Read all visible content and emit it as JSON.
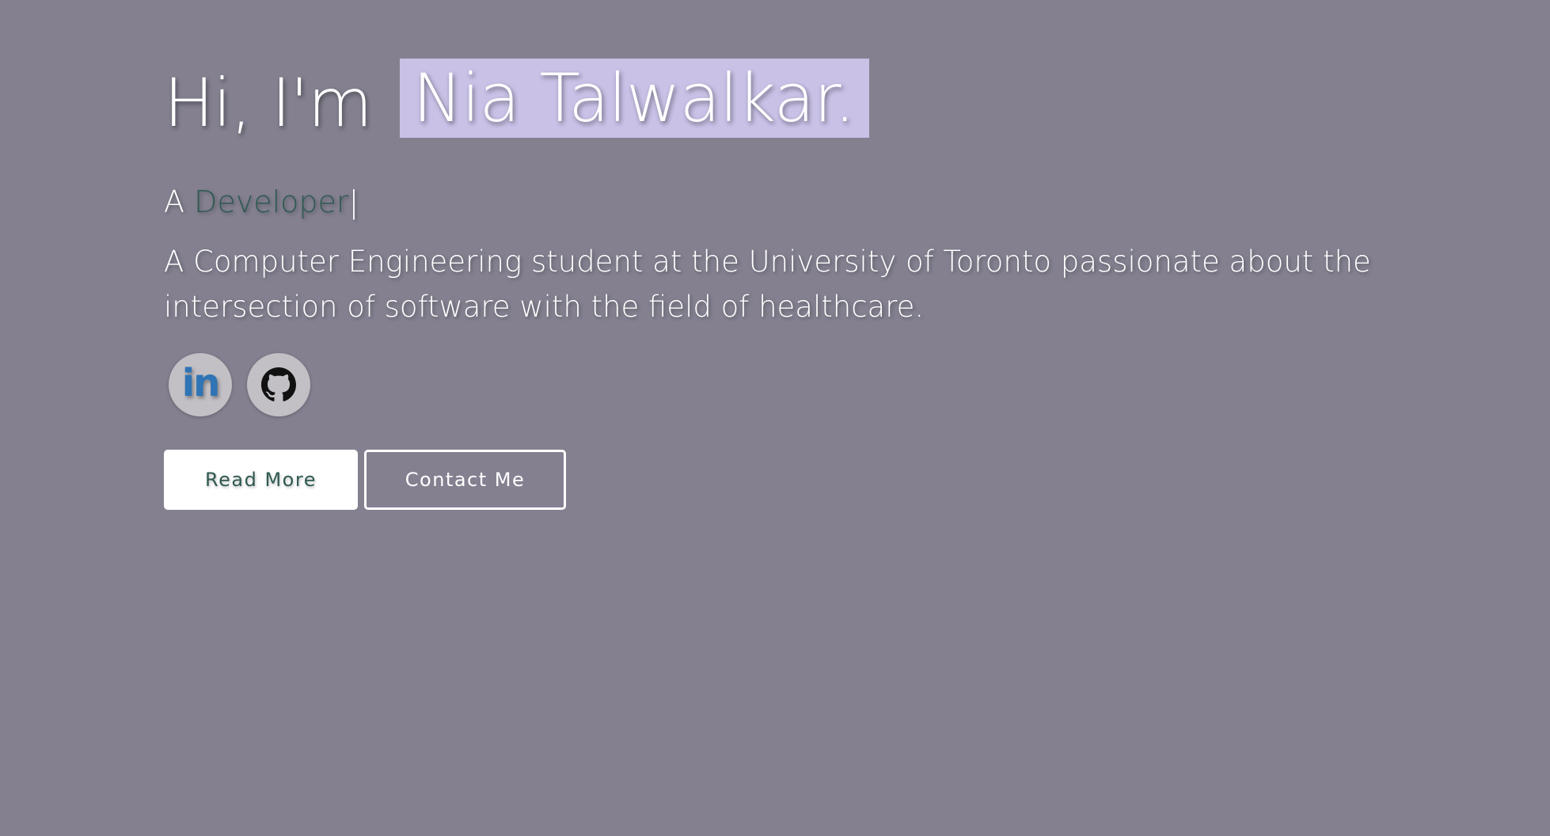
{
  "hero": {
    "greeting_prefix": "Hi, I'm",
    "name": "Nia Talwalkar.",
    "tagline_prefix": "A",
    "tagline_role": "Developer",
    "tagline_cursor": "|",
    "bio": "A Computer Engineering student at the University of Toronto passionate about the intersection of software with the field of healthcare."
  },
  "socials": {
    "linkedin_glyph": "in",
    "linkedin_icon": "linkedin-icon",
    "github_icon": "github-icon"
  },
  "buttons": {
    "read_more": "Read More",
    "contact_me": "Contact Me"
  },
  "colors": {
    "background": "#848090",
    "name_highlight": "#c9c1e6",
    "accent_text": "#2f5a52",
    "linkedin_blue": "#2f74b5"
  }
}
